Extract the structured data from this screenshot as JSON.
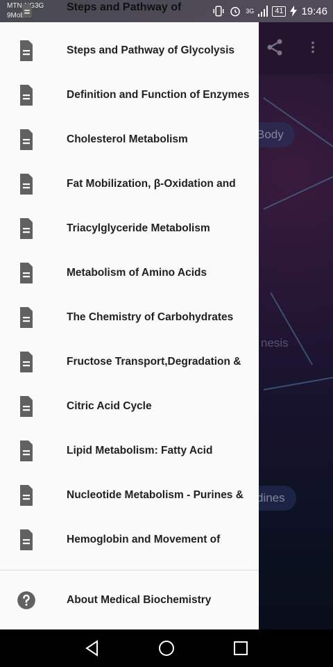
{
  "status_bar": {
    "carrier_line1": "MTN-NG3G",
    "carrier_line2": "9Mobile",
    "battery": "41",
    "time": "19:46",
    "network_badge": "3G"
  },
  "background": {
    "pill_1": "Body",
    "ghost_text": "nesis",
    "pill_2": "dines"
  },
  "drawer": {
    "peek_title": "Steps and Pathway of",
    "items": [
      {
        "label": "Steps and Pathway of Glycolysis",
        "icon": "document-icon"
      },
      {
        "label": "Definition and Function of Enzymes",
        "icon": "document-icon"
      },
      {
        "label": "Cholesterol Metabolism",
        "icon": "document-icon"
      },
      {
        "label": "Fat Mobilization, β-Oxidation and",
        "icon": "document-icon"
      },
      {
        "label": "Triacylglyceride Metabolism",
        "icon": "document-icon"
      },
      {
        "label": "Metabolism of Amino Acids",
        "icon": "document-icon"
      },
      {
        "label": "The Chemistry of Carbohydrates",
        "icon": "document-icon"
      },
      {
        "label": "Fructose Transport,Degradation &",
        "icon": "document-icon"
      },
      {
        "label": "Citric Acid Cycle",
        "icon": "document-icon"
      },
      {
        "label": "Lipid Metabolism: Fatty Acid",
        "icon": "document-icon"
      },
      {
        "label": "Nucleotide Metabolism - Purines &",
        "icon": "document-icon"
      },
      {
        "label": "Hemoglobin and Movement of",
        "icon": "document-icon"
      }
    ],
    "about": {
      "label": "About Medical Biochemistry",
      "icon": "help-circle-icon"
    }
  },
  "colors": {
    "drawer_bg": "#fafafa",
    "icon": "#616161",
    "text": "#212121"
  }
}
